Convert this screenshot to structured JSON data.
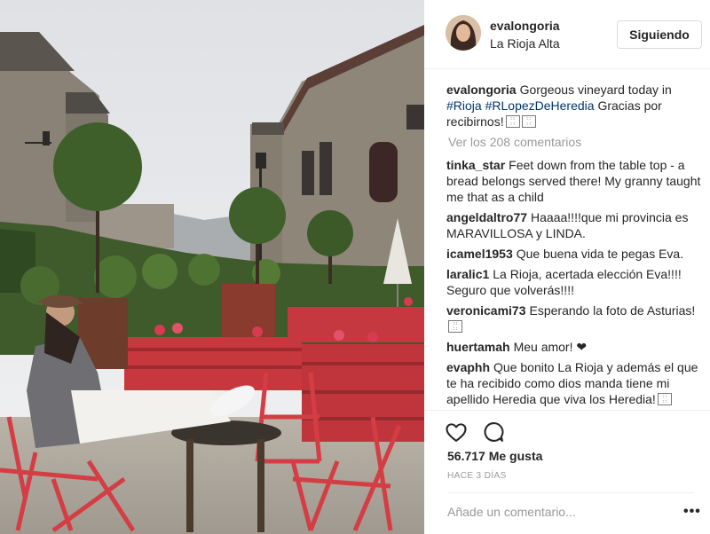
{
  "post": {
    "username": "evalongoria",
    "location": "La Rioja Alta",
    "follow_label": "Siguiendo"
  },
  "caption": {
    "username": "evalongoria",
    "text_1": "Gorgeous vineyard today in",
    "hashtag_1": "#Rioja",
    "hashtag_2": "#RLopezDeHeredia",
    "text_2": "Gracias por recibirnos!"
  },
  "view_comments_label": "Ver los 208 comentarios",
  "comments": [
    {
      "user": "tinka_star",
      "text": "Feet down from the table top - a bread belongs served there! My granny taught me that as a child"
    },
    {
      "user": "angeldaltro77",
      "text": "Haaaa!!!!que mi provincia es MARAVILLOSA y LINDA."
    },
    {
      "user": "icamel1953",
      "text": "Que buena vida te pegas Eva."
    },
    {
      "user": "laralic1",
      "text": "La Rioja, acertada elección Eva!!!! Seguro que volverás!!!!"
    },
    {
      "user": "veronicami73",
      "text": "Esperando la foto de Asturias!"
    },
    {
      "user": "huertamah",
      "text": "Meu amor! ❤"
    },
    {
      "user": "evaphh",
      "text": "Que bonito La Rioja y además el que te ha recibido como dios manda tiene mi apellido Heredia que viva los Heredia!"
    }
  ],
  "icons": {
    "like": "heart-icon",
    "comment": "comment-bubble-icon",
    "more": "more-options-icon",
    "emoji": "emoji-glyph"
  },
  "likes_label": "56.717 Me gusta",
  "time_label": "HACE 3 DÍAS",
  "add_comment_placeholder": "Añade un comentario...",
  "more_glyph": "•••",
  "colors": {
    "hashtag": "#003569",
    "text": "#262626",
    "muted": "#999999",
    "pallet_red": "#c7373e"
  }
}
